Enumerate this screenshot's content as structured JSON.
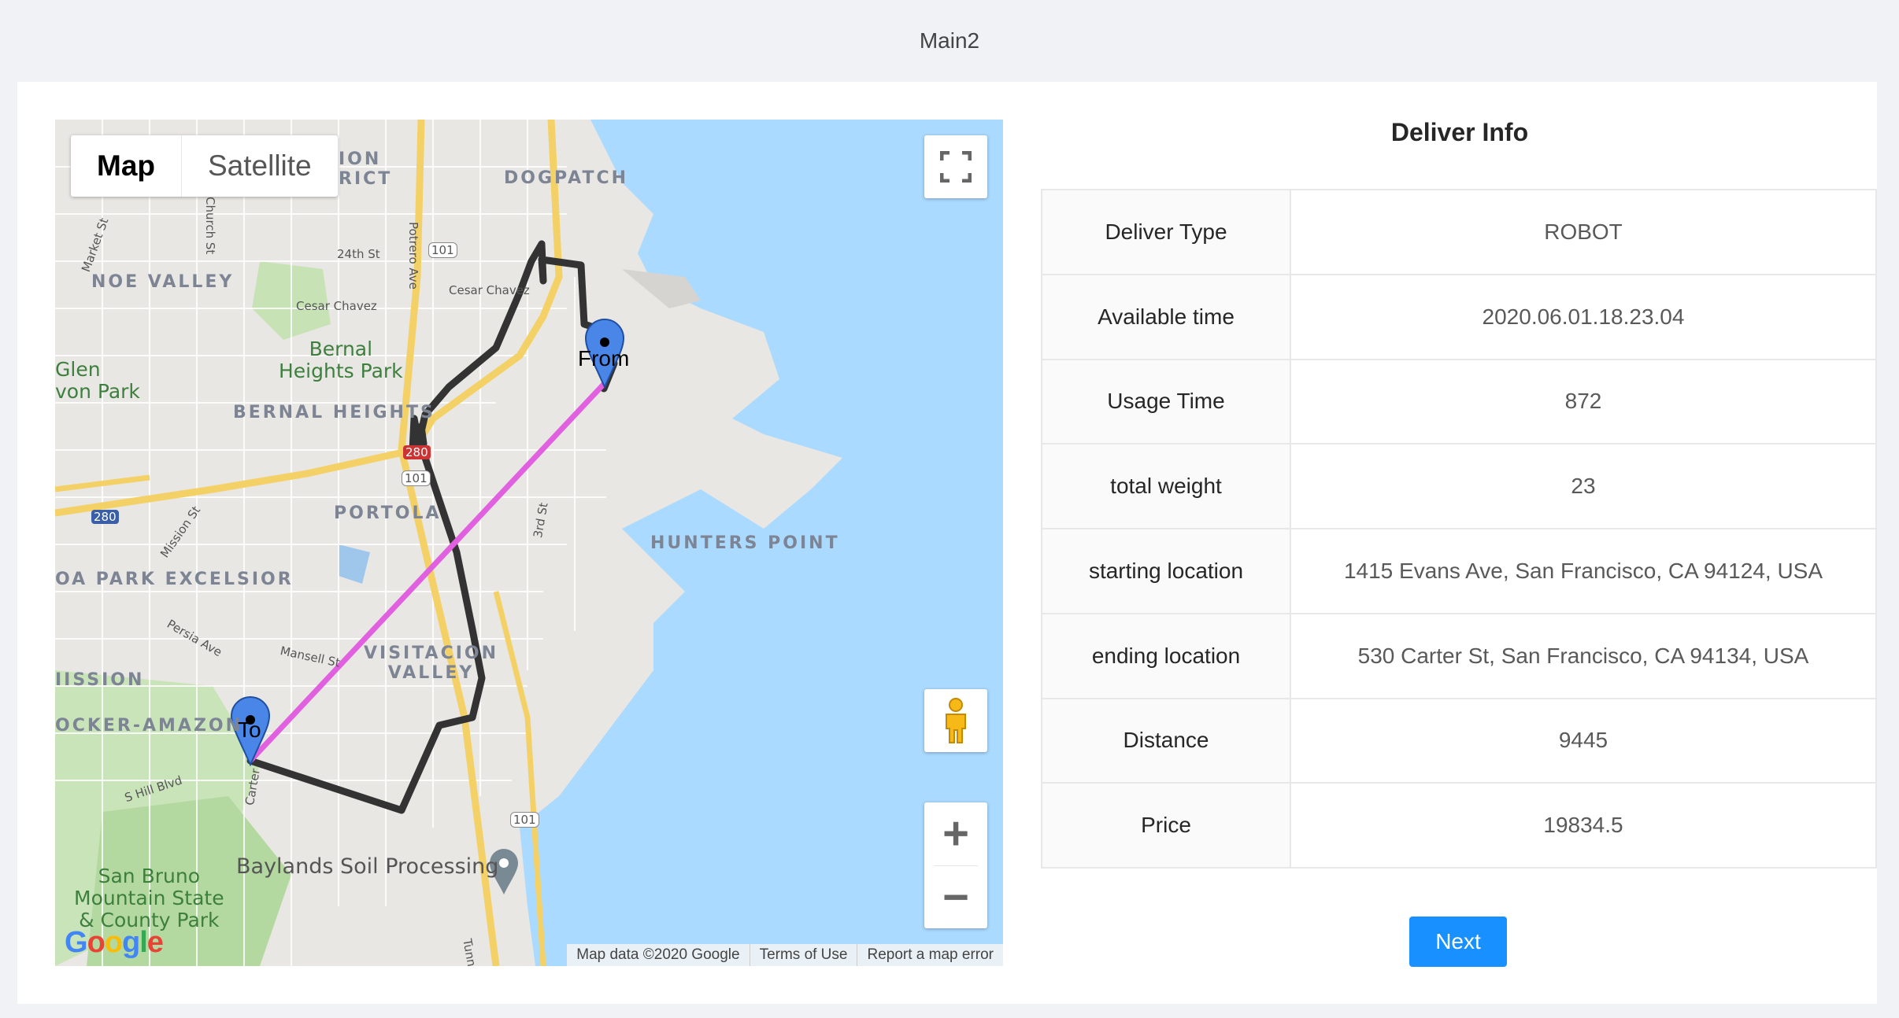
{
  "page": {
    "title": "Main2"
  },
  "map": {
    "type_buttons": [
      "Map",
      "Satellite"
    ],
    "markers": {
      "from": "From",
      "to": "To"
    },
    "labels": {
      "mission_district": "ION\nRICT",
      "dogpatch": "DOGPATCH",
      "noe_valley": "NOE VALLEY",
      "glen_park": "Glen\nvon Park",
      "bernal_park": "Bernal\nHeights Park",
      "bernal_heights": "BERNAL HEIGHTS",
      "portola": "PORTOLA",
      "hunters_point": "HUNTERS POINT",
      "excelsior": "OA PARK EXCELSIOR",
      "visitacion": "VISITACION\nVALLEY",
      "mission": "IISSION",
      "crocker": "OCKER-AMAZON",
      "san_bruno": "San Bruno\nMountain State\n& County Park",
      "baylands": "Baylands Soil Processing",
      "st_24th": "24th St",
      "cesar_chavez_w": "Cesar Chavez",
      "cesar_chavez_e": "Cesar Chavez",
      "potrero": "Potrero Ave",
      "church": "Church St",
      "marker_st": "Market St",
      "mission_st": "Mission St",
      "persia": "Persia Ave",
      "mansell": "Mansell St",
      "third_st": "3rd St",
      "hill_blvd": "S Hill Blvd",
      "carter": "Carter",
      "tunnel": "Tunn",
      "hwy101a": "101",
      "hwy101b": "101",
      "hwy101c": "101",
      "hwy280a": "280",
      "hwy280b": "280"
    },
    "google_logo": "Google",
    "attribution": [
      "Map data ©2020 Google",
      "Terms of Use",
      "Report a map error"
    ],
    "zoom_in": "+",
    "zoom_out": "−"
  },
  "info": {
    "title": "Deliver Info",
    "rows": [
      {
        "label": "Deliver Type",
        "value": "ROBOT"
      },
      {
        "label": "Available time",
        "value": "2020.06.01.18.23.04"
      },
      {
        "label": "Usage Time",
        "value": "872"
      },
      {
        "label": "total weight",
        "value": "23"
      },
      {
        "label": "starting location",
        "value": "1415 Evans Ave, San Francisco, CA 94124, USA"
      },
      {
        "label": "ending location",
        "value": "530 Carter St, San Francisco, CA 94134, USA"
      },
      {
        "label": "Distance",
        "value": "9445"
      },
      {
        "label": "Price",
        "value": "19834.5"
      }
    ]
  },
  "actions": {
    "next_label": "Next"
  },
  "colors": {
    "primary": "#1890ff",
    "route": "#333333",
    "straight_line": "#e060e0",
    "water": "#aadaff"
  }
}
